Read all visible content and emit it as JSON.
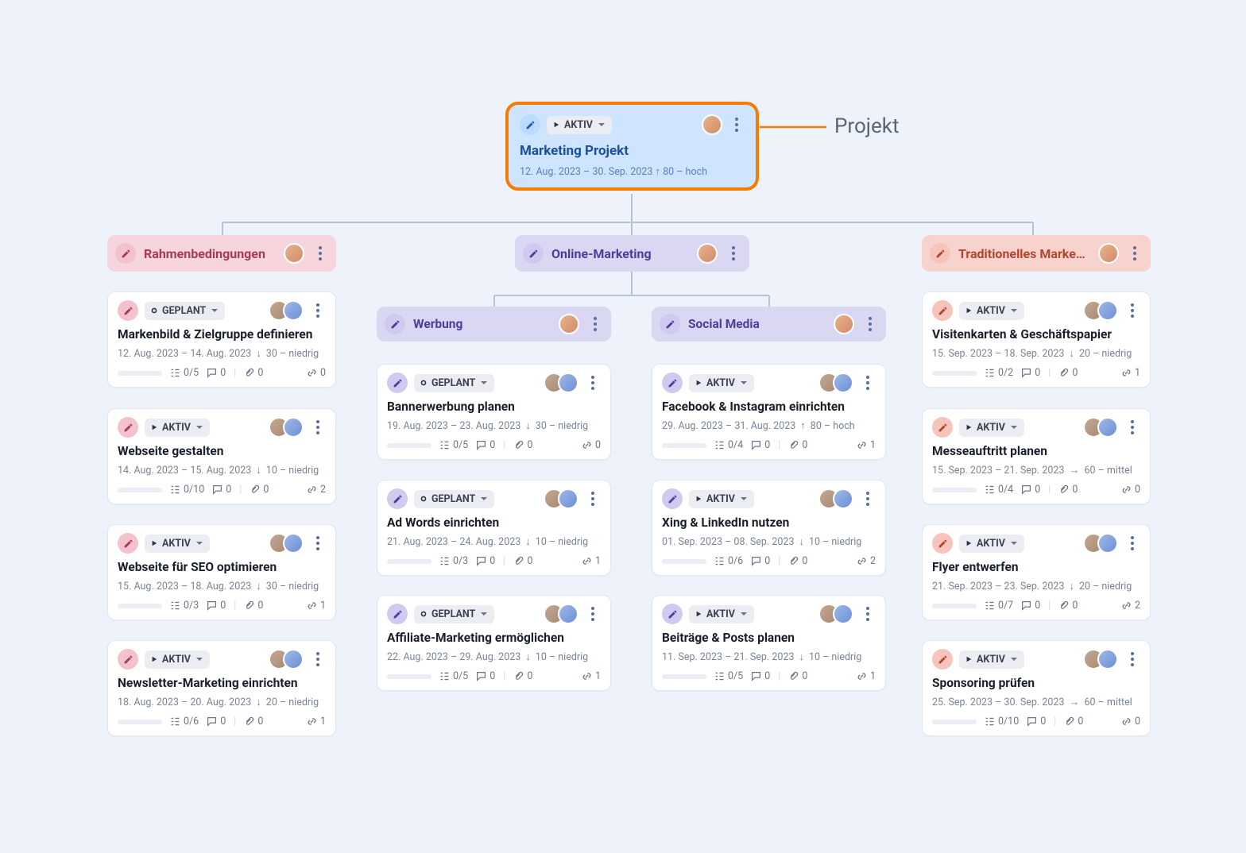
{
  "annotation": {
    "label": "Projekt"
  },
  "status_labels": {
    "aktiv": "AKTIV",
    "geplant": "GEPLANT"
  },
  "root": {
    "title": "Marketing Projekt",
    "dates": "12. Aug. 2023 – 30. Sep. 2023",
    "priority": "80 – hoch",
    "priority_dir": "up"
  },
  "groups": {
    "rahmen": {
      "title": "Rahmenbedingungen"
    },
    "online": {
      "title": "Online-Marketing"
    },
    "trad": {
      "title": "Traditionelles Marke…"
    },
    "werbung": {
      "title": "Werbung"
    },
    "social": {
      "title": "Social Media"
    }
  },
  "cards": {
    "r1": {
      "status": "geplant",
      "title": "Markenbild & Zielgruppe definieren",
      "dates": "12. Aug. 2023 – 14. Aug. 2023",
      "pri_dir": "down",
      "priority": "30 – niedrig",
      "check": "0/5",
      "comments": "0",
      "attach": "0",
      "links": "0"
    },
    "r2": {
      "status": "aktiv",
      "title": "Webseite gestalten",
      "dates": "14. Aug. 2023 – 15. Aug. 2023",
      "pri_dir": "down",
      "priority": "10 – niedrig",
      "check": "0/10",
      "comments": "0",
      "attach": "0",
      "links": "2"
    },
    "r3": {
      "status": "aktiv",
      "title": "Webseite für SEO optimieren",
      "dates": "15. Aug. 2023 – 18. Aug. 2023",
      "pri_dir": "down",
      "priority": "30 – niedrig",
      "check": "0/3",
      "comments": "0",
      "attach": "0",
      "links": "1"
    },
    "r4": {
      "status": "aktiv",
      "title": "Newsletter-Marketing einrichten",
      "dates": "18. Aug. 2023 – 20. Aug. 2023",
      "pri_dir": "down",
      "priority": "20 – niedrig",
      "check": "0/6",
      "comments": "0",
      "attach": "0",
      "links": "1"
    },
    "w1": {
      "status": "geplant",
      "title": "Bannerwerbung planen",
      "dates": "19. Aug. 2023 – 23. Aug. 2023",
      "pri_dir": "down",
      "priority": "30 – niedrig",
      "check": "0/5",
      "comments": "0",
      "attach": "0",
      "links": "0"
    },
    "w2": {
      "status": "geplant",
      "title": "Ad Words einrichten",
      "dates": "21. Aug. 2023 – 24. Aug. 2023",
      "pri_dir": "down",
      "priority": "10 – niedrig",
      "check": "0/3",
      "comments": "0",
      "attach": "0",
      "links": "1"
    },
    "w3": {
      "status": "geplant",
      "title": "Affiliate-Marketing ermöglichen",
      "dates": "22. Aug. 2023 – 29. Aug. 2023",
      "pri_dir": "down",
      "priority": "10 – niedrig",
      "check": "0/5",
      "comments": "0",
      "attach": "0",
      "links": "1"
    },
    "s1": {
      "status": "aktiv",
      "title": "Facebook & Instagram einrichten",
      "dates": "29. Aug. 2023 – 31. Aug. 2023",
      "pri_dir": "up",
      "priority": "80 – hoch",
      "check": "0/4",
      "comments": "0",
      "attach": "0",
      "links": "1"
    },
    "s2": {
      "status": "aktiv",
      "title": "Xing & LinkedIn nutzen",
      "dates": "01. Sep. 2023 – 08. Sep. 2023",
      "pri_dir": "down",
      "priority": "10 – niedrig",
      "check": "0/6",
      "comments": "0",
      "attach": "0",
      "links": "2"
    },
    "s3": {
      "status": "aktiv",
      "title": "Beiträge & Posts planen",
      "dates": "11. Sep. 2023 – 21. Sep. 2023",
      "pri_dir": "down",
      "priority": "10 – niedrig",
      "check": "0/5",
      "comments": "0",
      "attach": "0",
      "links": "1"
    },
    "t1": {
      "status": "aktiv",
      "title": "Visitenkarten & Geschäftspapier",
      "dates": "15. Sep. 2023 – 18. Sep. 2023",
      "pri_dir": "down",
      "priority": "20 – niedrig",
      "check": "0/2",
      "comments": "0",
      "attach": "0",
      "links": "1"
    },
    "t2": {
      "status": "aktiv",
      "title": "Messeauftritt planen",
      "dates": "15. Sep. 2023 – 21. Sep. 2023",
      "pri_dir": "right",
      "priority": "60 – mittel",
      "check": "0/4",
      "comments": "0",
      "attach": "0",
      "links": "0"
    },
    "t3": {
      "status": "aktiv",
      "title": "Flyer entwerfen",
      "dates": "21. Sep. 2023 – 23. Sep. 2023",
      "pri_dir": "down",
      "priority": "20 – niedrig",
      "check": "0/7",
      "comments": "0",
      "attach": "0",
      "links": "2"
    },
    "t4": {
      "status": "aktiv",
      "title": "Sponsoring prüfen",
      "dates": "25. Sep. 2023 – 30. Sep. 2023",
      "pri_dir": "right",
      "priority": "60 – mittel",
      "check": "0/10",
      "comments": "0",
      "attach": "0",
      "links": "0"
    }
  }
}
